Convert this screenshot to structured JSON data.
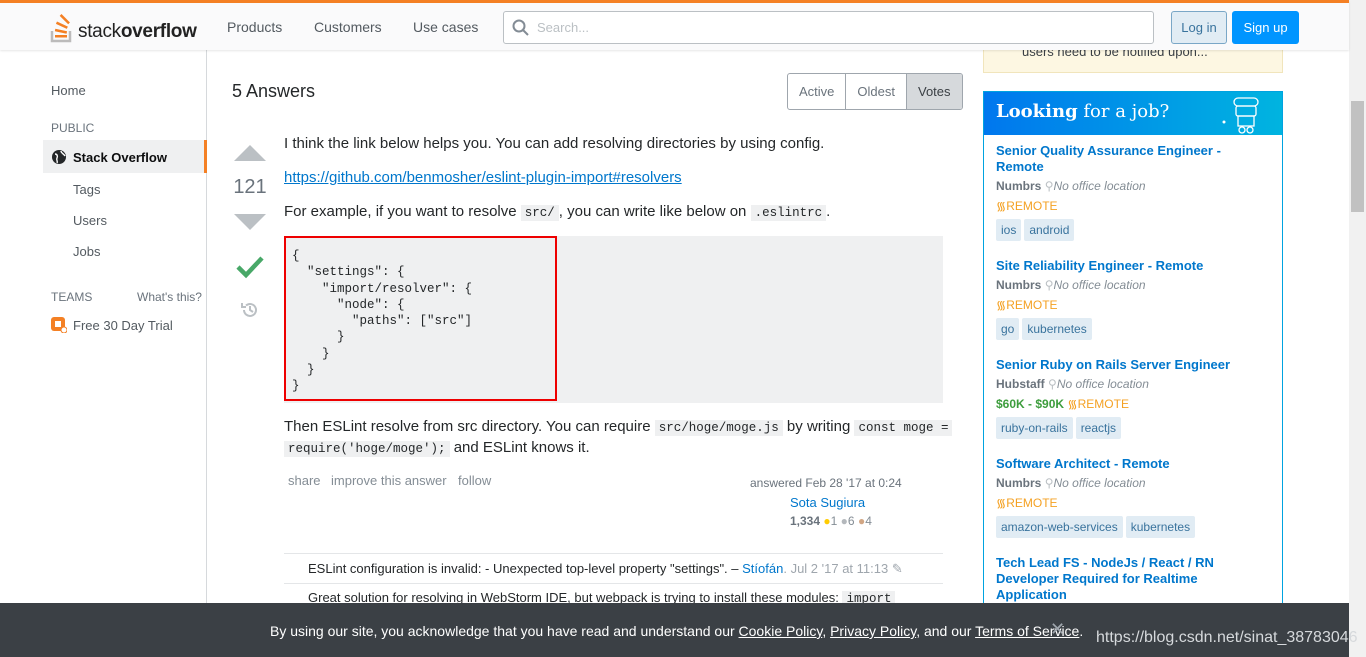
{
  "header": {
    "logo_text_light": "stack",
    "logo_text_bold": "overflow",
    "nav": [
      "Products",
      "Customers",
      "Use cases"
    ],
    "search_placeholder": "Search...",
    "login": "Log in",
    "signup": "Sign up"
  },
  "leftnav": {
    "home": "Home",
    "public": "PUBLIC",
    "stack_overflow": "Stack Overflow",
    "tags": "Tags",
    "users": "Users",
    "jobs": "Jobs",
    "teams": "TEAMS",
    "whats_this": "What's this?",
    "free_trial": "Free 30 Day Trial"
  },
  "answers": {
    "title": "5 Answers",
    "tabs": [
      {
        "label": "Active",
        "selected": false
      },
      {
        "label": "Oldest",
        "selected": false
      },
      {
        "label": "Votes",
        "selected": true
      }
    ]
  },
  "answer": {
    "votes": "121",
    "p1": "I think the link below helps you. You can add resolving directories by using config.",
    "link": "https://github.com/benmosher/eslint-plugin-import#resolvers",
    "p2_a": "For example, if you want to resolve ",
    "p2_code1": "src/",
    "p2_b": ", you can write like below on ",
    "p2_code2": ".eslintrc",
    "p2_c": ".",
    "code": "{\n  \"settings\": {\n    \"import/resolver\": {\n      \"node\": {\n        \"paths\": [\"src\"]\n      }\n    }\n  }\n}",
    "p3_a": "Then ESLint resolve from src directory. You can require ",
    "p3_code1": "src/hoge/moge.js",
    "p3_b": " by writing ",
    "p3_code2a": "const moge =",
    "p3_code2b": "require('hoge/moge');",
    "p3_c": " and ESLint knows it.",
    "menu": [
      "share",
      "improve this answer",
      "follow"
    ],
    "answered": "answered Feb 28 '17 at 0:24",
    "user": "Sota Sugiura",
    "rep": "1,334",
    "gold": "1",
    "silver": "6",
    "bronze": "4"
  },
  "comments": [
    {
      "text": "ESLint configuration is invalid: - Unexpected top-level property \"settings\". – ",
      "user": "Stíofán",
      "date": "Jul 2 '17 at 11:13"
    },
    {
      "text": "Great solution for resolving in WebStorm IDE, but webpack is trying to install these modules: ",
      "code": "import"
    }
  ],
  "sidebar": {
    "note": "users need to be notified upon...",
    "jobs_title_bold": "Looking",
    "jobs_title_rest": " for a job?",
    "jobs": [
      {
        "title": "Senior Quality Assurance Engineer - Remote",
        "company": "Numbrs",
        "location": "No office location",
        "salary": "",
        "remote": "REMOTE",
        "tags": [
          "ios",
          "android"
        ]
      },
      {
        "title": "Site Reliability Engineer - Remote",
        "company": "Numbrs",
        "location": "No office location",
        "salary": "",
        "remote": "REMOTE",
        "tags": [
          "go",
          "kubernetes"
        ]
      },
      {
        "title": "Senior Ruby on Rails Server Engineer",
        "company": "Hubstaff",
        "location": "No office location",
        "salary": "$60K - $90K",
        "remote": "REMOTE",
        "tags": [
          "ruby-on-rails",
          "reactjs"
        ]
      },
      {
        "title": "Software Architect - Remote",
        "company": "Numbrs",
        "location": "No office location",
        "salary": "",
        "remote": "REMOTE",
        "tags": [
          "amazon-web-services",
          "kubernetes"
        ]
      },
      {
        "title": "Tech Lead FS - NodeJs / React / RN Developer Required for Realtime Application",
        "company": "",
        "location": "",
        "salary": "",
        "remote": "",
        "tags": []
      }
    ]
  },
  "cookie": {
    "text_a": "By using our site, you acknowledge that you have read and understand our ",
    "cookie_policy": "Cookie Policy",
    "sep1": ", ",
    "privacy_policy": "Privacy Policy",
    "sep2": ", and our ",
    "terms": "Terms of Service",
    "end": "."
  },
  "watermark": "https://blog.csdn.net/sinat_38783046",
  "colors": {
    "accent": "#f48024",
    "link": "#0077cc",
    "accepted": "#48a868",
    "highlight_box": "#ee0000"
  }
}
